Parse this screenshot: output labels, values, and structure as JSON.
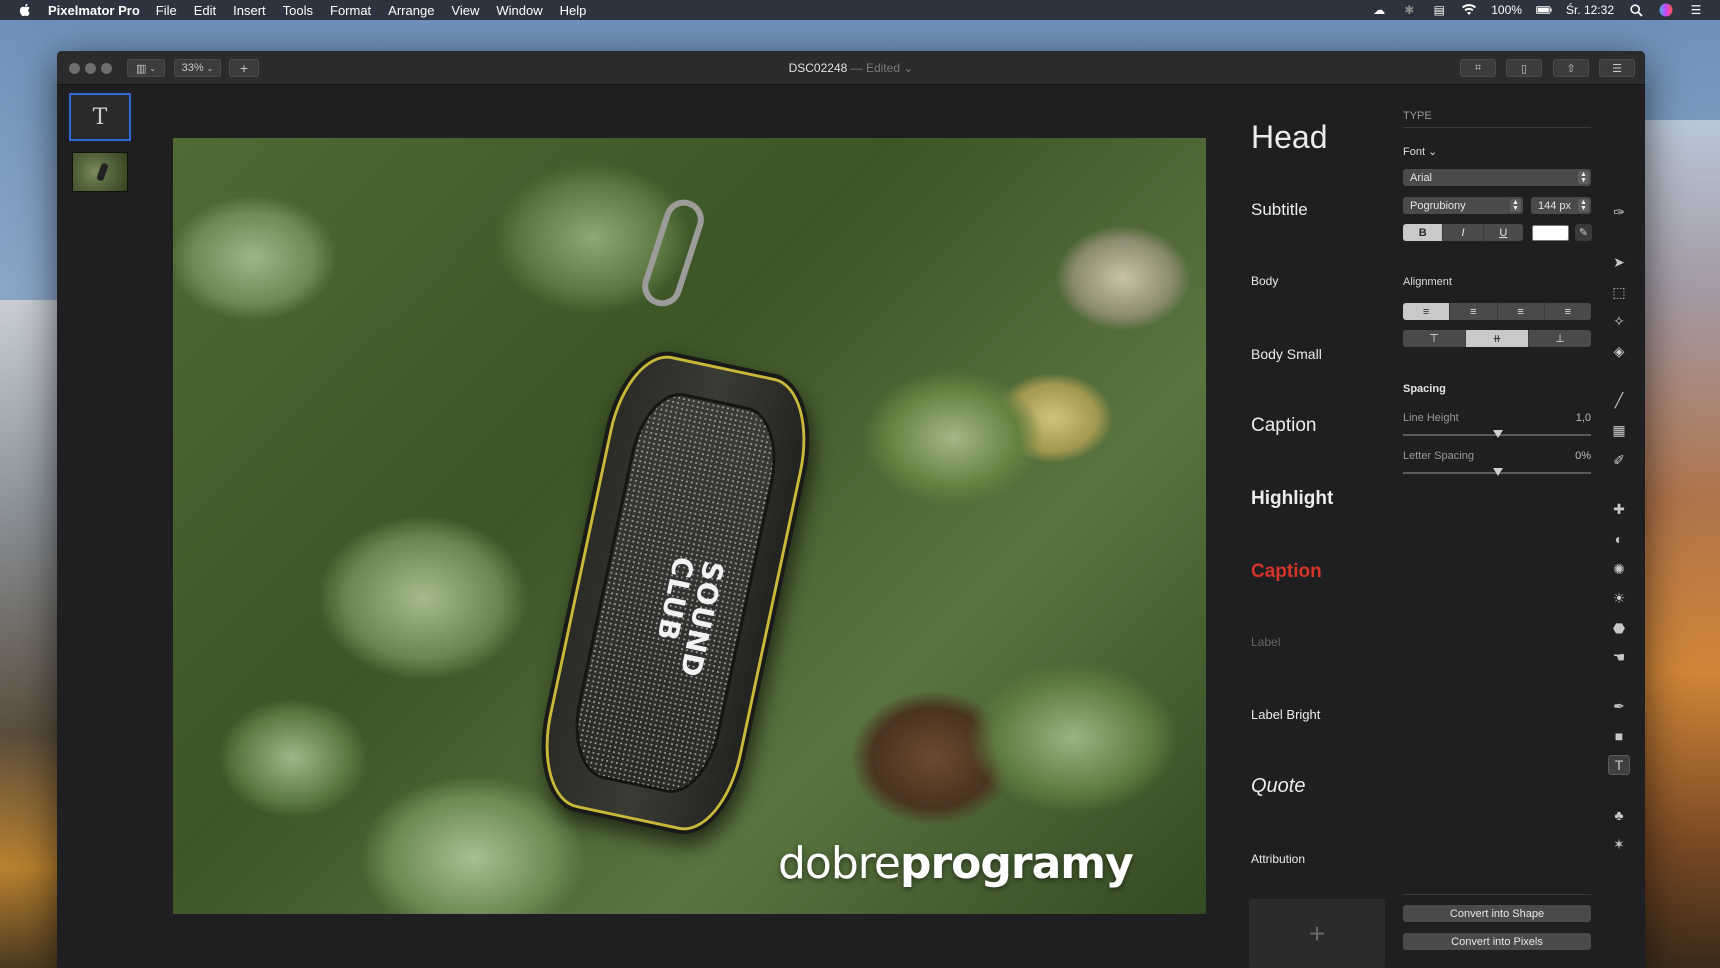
{
  "menubar": {
    "app_name": "Pixelmator Pro",
    "items": [
      "File",
      "Edit",
      "Insert",
      "Tools",
      "Format",
      "Arrange",
      "View",
      "Window",
      "Help"
    ],
    "battery": "100%",
    "clock": "Śr. 12:32"
  },
  "window": {
    "doc_name": "DSC02248",
    "doc_status": "— Edited ⌄",
    "zoom": "33%",
    "add_label": "+"
  },
  "layers": {
    "text_layer_glyph": "T"
  },
  "photo": {
    "logo_text": "SOUND CLUB",
    "watermark_light": "dobre",
    "watermark_bold": "programy"
  },
  "styles": {
    "head": "Head",
    "subtitle": "Subtitle",
    "body": "Body",
    "body_small": "Body Small",
    "caption": "Caption",
    "highlight": "Highlight",
    "caption_red": "Caption",
    "label": "Label",
    "label_bright": "Label Bright",
    "quote": "Quote",
    "attribution": "Attribution",
    "add": "+"
  },
  "inspector": {
    "section": "TYPE",
    "font_heading": "Font ⌄",
    "font_family": "Arial",
    "font_style": "Pogrubiony",
    "font_size": "144 px",
    "bold": "B",
    "italic": "I",
    "underline": "U",
    "alignment_heading": "Alignment",
    "spacing_heading": "Spacing",
    "line_height_label": "Line Height",
    "line_height_value": "1,0",
    "letter_spacing_label": "Letter Spacing",
    "letter_spacing_value": "0%",
    "convert_shape": "Convert into Shape",
    "convert_pixels": "Convert into Pixels",
    "text_color": "#ffffff"
  },
  "icons": {
    "apple": "apple-icon",
    "wifi": "wifi-icon",
    "search": "search-icon"
  }
}
